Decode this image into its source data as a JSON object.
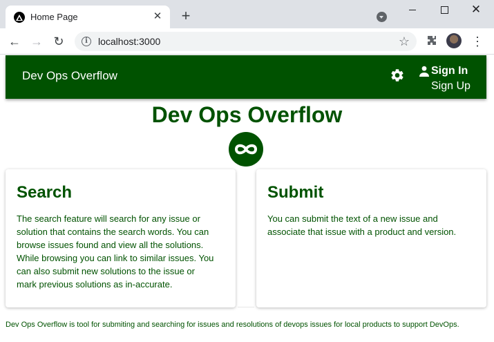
{
  "browser": {
    "tab_title": "Home Page",
    "url": "localhost:3000"
  },
  "header": {
    "brand": "Dev Ops Overflow",
    "sign_in": "Sign In",
    "sign_up": "Sign Up",
    "icons": [
      "gear-icon",
      "user-icon"
    ]
  },
  "main": {
    "title": "Dev Ops Overflow",
    "logo_icon": "infinity-icon",
    "cards": [
      {
        "title": "Search",
        "body": "The search feature will search for any issue or solution that contains the search words. You can browse issues found and view all the solutions. While browsing you can link to similar issues. You can also submit new solutions to the issue or mark previous solutions as in-accurate."
      },
      {
        "title": "Submit",
        "body": "You can submit the text of a new issue and associate that issue with a product and version."
      }
    ]
  },
  "footer": {
    "text": "Dev Ops Overflow is tool for submiting and searching for issues and resolutions of devops issues for local products to support DevOps."
  },
  "colors": {
    "brand_green": "#005200",
    "chrome_tabstrip": "#dee1e6",
    "omnibox": "#f1f3f4"
  }
}
